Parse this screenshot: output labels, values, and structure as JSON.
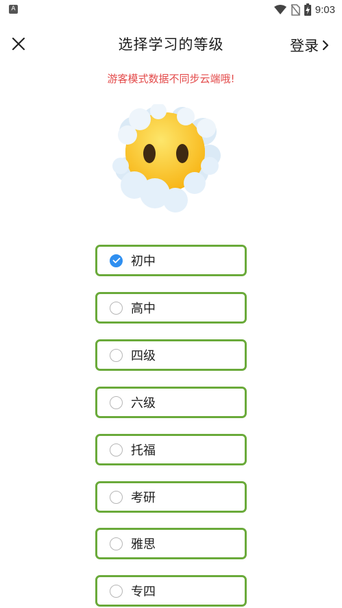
{
  "status_bar": {
    "time": "9:03",
    "app_icon": "A"
  },
  "header": {
    "close_icon": "close-icon",
    "title": "选择学习的等级",
    "login_label": "登录"
  },
  "notice": "游客模式数据不同步云端哦!",
  "illustration": "face-in-clouds-emoji",
  "options": [
    {
      "label": "初中",
      "selected": true
    },
    {
      "label": "高中",
      "selected": false
    },
    {
      "label": "四级",
      "selected": false
    },
    {
      "label": "六级",
      "selected": false
    },
    {
      "label": "托福",
      "selected": false
    },
    {
      "label": "考研",
      "selected": false
    },
    {
      "label": "雅思",
      "selected": false
    },
    {
      "label": "专四",
      "selected": false
    }
  ],
  "colors": {
    "accent_border": "#6aaa3a",
    "radio_checked": "#2f8ff0",
    "notice": "#e34a4a"
  }
}
